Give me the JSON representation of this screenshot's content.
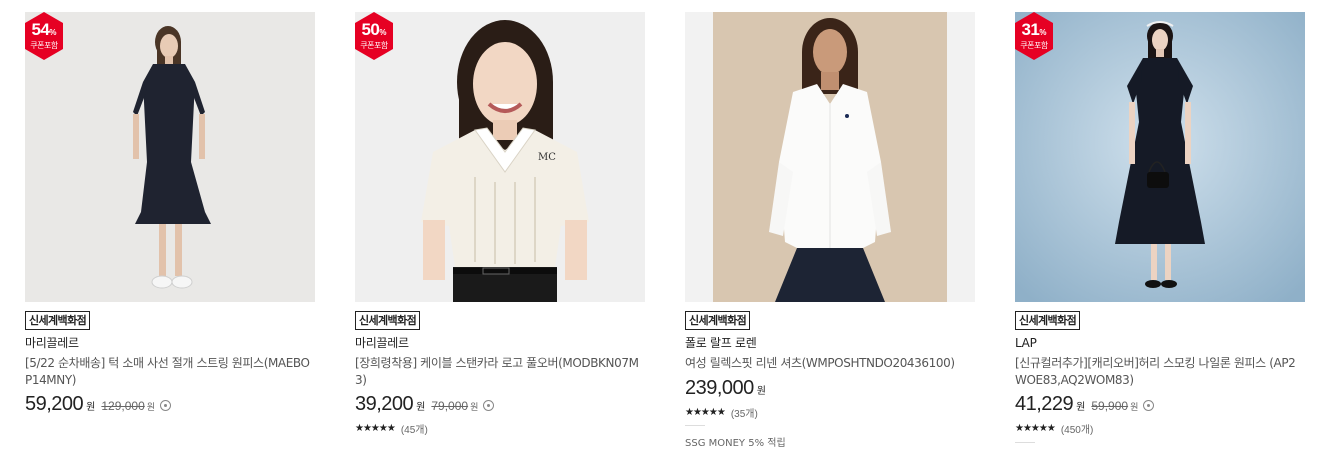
{
  "products": [
    {
      "badge": {
        "percent": "54",
        "unit": "%",
        "label": "쿠폰포함"
      },
      "store_tag": "신세계백화점",
      "brand": "마리끌레르",
      "title": "[5/22 순차배송] 턱 소매 사선 절개 스트링 원피스(MAEBOP14MNY)",
      "price": "59,200",
      "currency": "원",
      "original_price": "129,000",
      "original_currency": "원"
    },
    {
      "badge": {
        "percent": "50",
        "unit": "%",
        "label": "쿠폰포함"
      },
      "store_tag": "신세계백화점",
      "brand": "마리끌레르",
      "title": "[장희령착용] 케이블 스탠카라 로고 풀오버(MODBKN07M3)",
      "price": "39,200",
      "currency": "원",
      "original_price": "79,000",
      "original_currency": "원",
      "rating_stars": "★★★★★",
      "review_count": "(45개)"
    },
    {
      "store_tag": "신세계백화점",
      "brand": "폴로 랄프 로렌",
      "title": "여성 릴렉스핏 리넨 셔츠(WMPOSHTNDO20436100)",
      "price": "239,000",
      "currency": "원",
      "rating_stars": "★★★★★",
      "review_count": "(35개)",
      "benefit": "SSG MONEY 5% 적립"
    },
    {
      "badge": {
        "percent": "31",
        "unit": "%",
        "label": "쿠폰포함"
      },
      "store_tag": "신세계백화점",
      "brand": "LAP",
      "title": "[신규컬러추가][캐리오버]허리 스모킹 나일론 원피스 (AP2WOE83,AQ2WOM83)",
      "price": "41,229",
      "currency": "원",
      "original_price": "59,900",
      "original_currency": "원",
      "rating_stars": "★★★★★",
      "review_count": "(450개)"
    }
  ],
  "colors": {
    "badge_red": "#e60023",
    "text_primary": "#222222",
    "text_secondary": "#666666"
  }
}
